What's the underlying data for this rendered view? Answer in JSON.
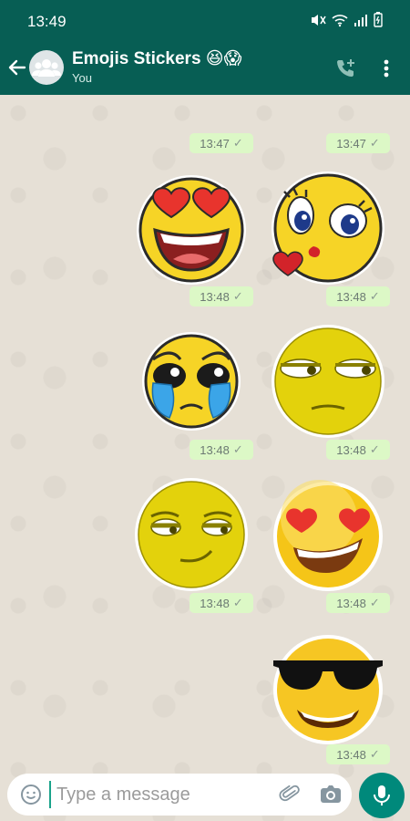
{
  "status_bar": {
    "time": "13:49"
  },
  "header": {
    "title": "Emojis Stickers 😆😱",
    "subtitle": "You"
  },
  "messages": [
    {
      "time": "13:47",
      "sticker": "plain-timestamp-icon"
    },
    {
      "time": "13:47",
      "sticker": "plain-timestamp-icon"
    },
    {
      "time": "13:48",
      "sticker": "heart-eyes-laughing-emoji"
    },
    {
      "time": "13:48",
      "sticker": "kissing-heart-emoji"
    },
    {
      "time": "13:48",
      "sticker": "pleading-crying-emoji"
    },
    {
      "time": "13:48",
      "sticker": "unamused-side-eye-emoji"
    },
    {
      "time": "13:48",
      "sticker": "smirking-emoji"
    },
    {
      "time": "13:48",
      "sticker": "heart-eyes-grin-emoji"
    },
    {
      "time": "13:48",
      "sticker": "sunglasses-emoji"
    }
  ],
  "input": {
    "placeholder": "Type a message"
  },
  "colors": {
    "header": "#075e54",
    "bubble": "#dcf8c6",
    "chat_bg": "#e6e0d6",
    "mic": "#00897b",
    "emoji_yellow": "#f6d426"
  }
}
